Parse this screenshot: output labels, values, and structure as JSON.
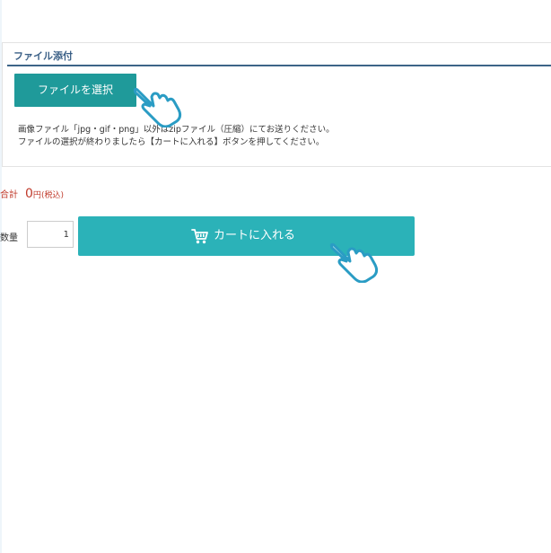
{
  "file_attach": {
    "title": "ファイル添付",
    "select_button": "ファイルを選択",
    "note_line1": "画像ファイル「jpg・gif・png」以外はzipファイル（圧縮）にてお送りください。",
    "note_line2": "ファイルの選択が終わりましたら【カートに入れる】ボタンを押してください。"
  },
  "total": {
    "label": "合計",
    "value": "0",
    "unit": "円",
    "tax": "(税込)"
  },
  "quantity": {
    "label": "数量",
    "value": "1"
  },
  "cart": {
    "button_label": "カートに入れる",
    "icon": "cart-icon"
  },
  "colors": {
    "select_button": "#1f9a9a",
    "cart_button": "#2bb2b8",
    "title": "#3a5f86",
    "price": "#c03a2b",
    "pointer": "#2a9cc4"
  }
}
